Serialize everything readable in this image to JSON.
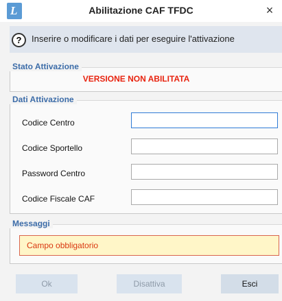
{
  "window": {
    "title": "Abilitazione CAF TFDC",
    "app_icon_letter": "L",
    "close_glyph": "×"
  },
  "info": {
    "icon": "question-icon",
    "text": "Inserire o modificare i dati per eseguire l'attivazione"
  },
  "stato": {
    "legend": "Stato Attivazione",
    "status": "VERSIONE NON ABILITATA",
    "status_color": "#e8230f"
  },
  "dati": {
    "legend": "Dati Attivazione",
    "fields": [
      {
        "label": "Codice Centro",
        "value": "",
        "placeholder": ""
      },
      {
        "label": "Codice Sportello",
        "value": "",
        "placeholder": ""
      },
      {
        "label": "Password Centro",
        "value": "",
        "placeholder": ""
      },
      {
        "label": "Codice Fiscale CAF",
        "value": "",
        "placeholder": ""
      }
    ]
  },
  "messaggi": {
    "legend": "Messaggi",
    "text": "Campo obbligatorio",
    "text_color": "#d9360f",
    "background": "#fff6c8"
  },
  "buttons": {
    "ok": {
      "label": "Ok",
      "enabled": false
    },
    "disattiva": {
      "label": "Disattiva",
      "enabled": false
    },
    "esci": {
      "label": "Esci",
      "enabled": true
    }
  },
  "colors": {
    "accent_legend": "#3c6ca8",
    "info_bar": "#dfe5ee",
    "focus_border": "#2f7bd6"
  }
}
